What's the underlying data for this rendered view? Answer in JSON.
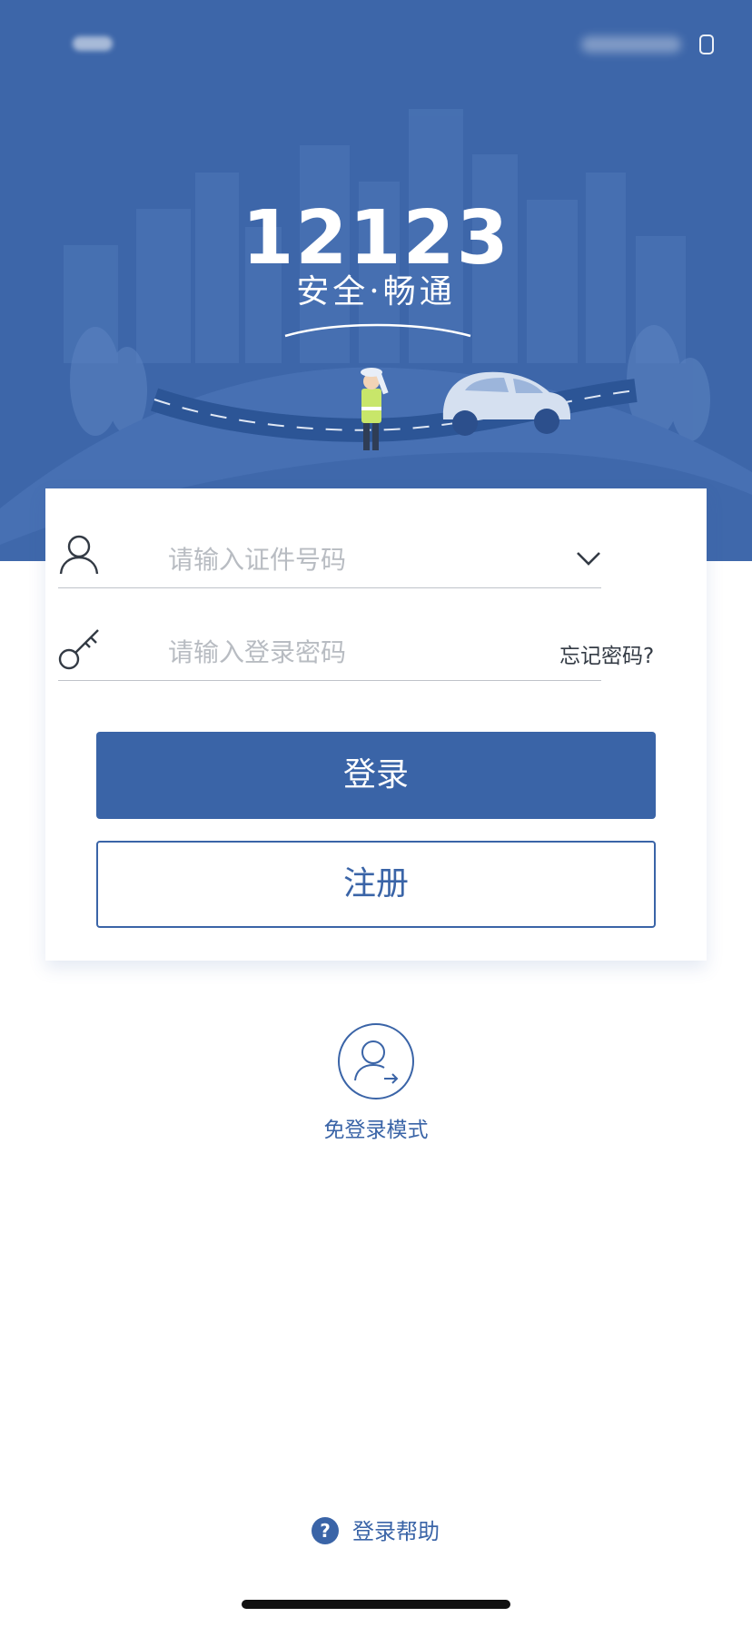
{
  "hero": {
    "brand_number": "12123",
    "slogan": "安全·畅通"
  },
  "login_form": {
    "id_placeholder": "请输入证件号码",
    "password_placeholder": "请输入登录密码",
    "forgot_password": "忘记密码?",
    "login_label": "登录",
    "register_label": "注册"
  },
  "guest_mode": {
    "label": "免登录模式"
  },
  "footer": {
    "help_label": "登录帮助"
  },
  "icons": {
    "user": "user-icon",
    "key": "key-icon",
    "dropdown": "chevron-down-icon",
    "guest": "guest-login-icon",
    "help": "question-circle-icon"
  },
  "colors": {
    "brand_blue": "#3a64a7",
    "hero_blue": "#3d66a9",
    "placeholder_gray": "#b8bcc2"
  }
}
